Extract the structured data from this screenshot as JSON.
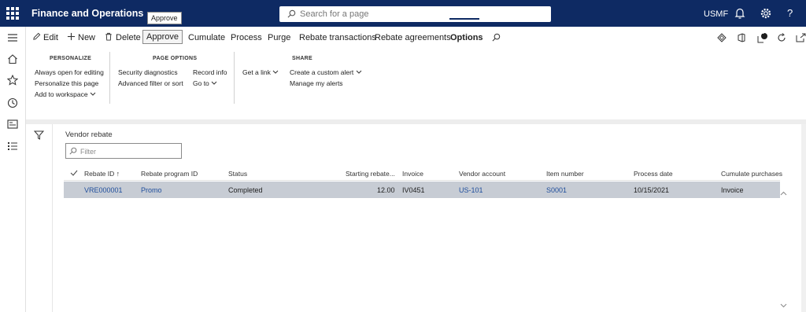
{
  "topbar": {
    "app_title": "Finance and Operations",
    "search_placeholder": "Search for a page",
    "company": "USMF",
    "help_label": "?"
  },
  "tooltip": "Approve",
  "actions": {
    "edit": "Edit",
    "new": "New",
    "delete": "Delete",
    "approve": "Approve",
    "cumulate": "Cumulate",
    "process": "Process",
    "purge": "Purge",
    "rebate_transactions": "Rebate transactions",
    "rebate_agreements": "Rebate agreements",
    "options": "Options"
  },
  "ribbon": {
    "personalize": {
      "title": "PERSONALIZE",
      "items": [
        "Always open for editing",
        "Personalize this page",
        "Add to workspace"
      ]
    },
    "page_options": {
      "title": "PAGE OPTIONS",
      "items": [
        "Security diagnostics",
        "Advanced filter or sort",
        "Record info",
        "Go to"
      ]
    },
    "get_link": "Get a link",
    "share": {
      "title": "SHARE",
      "items": [
        "Create a custom alert",
        "Manage my alerts"
      ]
    }
  },
  "notification_count": "0",
  "content": {
    "section_title": "Vendor rebate",
    "filter_placeholder": "Filter"
  },
  "grid": {
    "columns": [
      "Rebate ID",
      "Rebate program ID",
      "Status",
      "Starting rebate...",
      "Invoice",
      "Vendor account",
      "Item number",
      "Process date",
      "Cumulate purchases"
    ],
    "rows": [
      {
        "rebate_id": "VRE000001",
        "program_id": "Promo",
        "status": "Completed",
        "starting_rebate": "12.00",
        "invoice": "IV0451",
        "vendor_account": "US-101",
        "item_number": "S0001",
        "process_date": "10/15/2021",
        "cumulate_purchases": "Invoice"
      }
    ]
  },
  "colors": {
    "topbar": "#0e2a63",
    "link": "#1f4e9c",
    "selected_row": "#c7ccd4"
  }
}
